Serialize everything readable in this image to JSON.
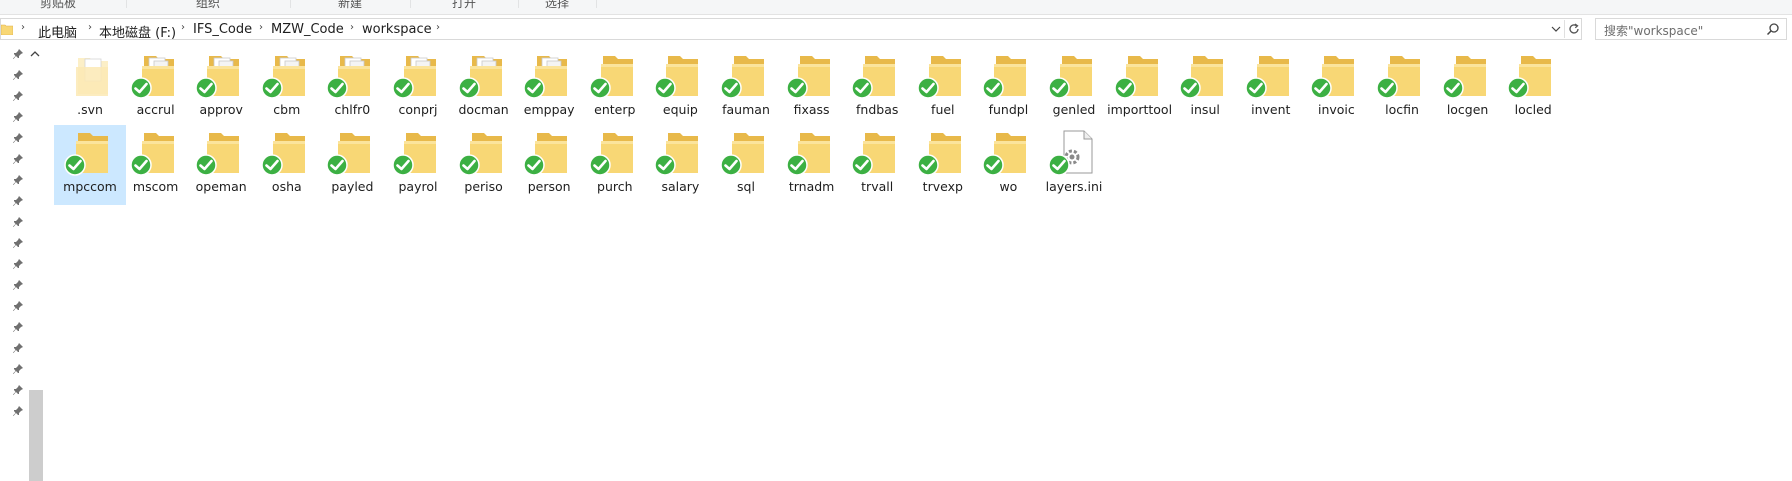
{
  "ribbon": {
    "groups": [
      "剪贴板",
      "组织",
      "新建",
      "打开",
      "选择"
    ]
  },
  "address": {
    "crumbs": [
      "此电脑",
      "本地磁盘 (F:)",
      "IFS_Code",
      "MZW_Code",
      "workspace"
    ],
    "dropdown_icon": "chevron-down-icon",
    "refresh_icon": "refresh-icon"
  },
  "search": {
    "placeholder": "搜索\"workspace\""
  },
  "colors": {
    "folder": "#f8d775",
    "folder_dark": "#e8b94a",
    "check_green": "#3cb043",
    "selected_bg": "#cce8ff"
  },
  "files": {
    "row1": [
      {
        "name": ".svn",
        "type": "folder-hidden",
        "overlay": "none"
      },
      {
        "name": "accrul",
        "type": "folder-docs",
        "overlay": "check"
      },
      {
        "name": "approv",
        "type": "folder-docs",
        "overlay": "check"
      },
      {
        "name": "cbm",
        "type": "folder-docs",
        "overlay": "check"
      },
      {
        "name": "chlfr0",
        "type": "folder-docs",
        "overlay": "check"
      },
      {
        "name": "conprj",
        "type": "folder-docs",
        "overlay": "check"
      },
      {
        "name": "docman",
        "type": "folder-docs",
        "overlay": "check"
      },
      {
        "name": "emppay",
        "type": "folder-docs",
        "overlay": "check"
      },
      {
        "name": "enterp",
        "type": "folder",
        "overlay": "check"
      },
      {
        "name": "equip",
        "type": "folder",
        "overlay": "check"
      },
      {
        "name": "fauman",
        "type": "folder",
        "overlay": "check"
      },
      {
        "name": "fixass",
        "type": "folder",
        "overlay": "check"
      },
      {
        "name": "fndbas",
        "type": "folder",
        "overlay": "check"
      },
      {
        "name": "fuel",
        "type": "folder",
        "overlay": "check"
      },
      {
        "name": "fundpl",
        "type": "folder",
        "overlay": "check"
      },
      {
        "name": "genled",
        "type": "folder",
        "overlay": "check"
      },
      {
        "name": "importtool",
        "type": "folder",
        "overlay": "check"
      },
      {
        "name": "insul",
        "type": "folder",
        "overlay": "check"
      },
      {
        "name": "invent",
        "type": "folder",
        "overlay": "check"
      },
      {
        "name": "invoic",
        "type": "folder",
        "overlay": "check"
      },
      {
        "name": "locfin",
        "type": "folder",
        "overlay": "check"
      },
      {
        "name": "locgen",
        "type": "folder",
        "overlay": "check"
      },
      {
        "name": "locled",
        "type": "folder",
        "overlay": "check"
      }
    ],
    "row2": [
      {
        "name": "mpccom",
        "type": "folder",
        "overlay": "check",
        "selected": true
      },
      {
        "name": "mscom",
        "type": "folder",
        "overlay": "check"
      },
      {
        "name": "opeman",
        "type": "folder",
        "overlay": "check"
      },
      {
        "name": "osha",
        "type": "folder",
        "overlay": "check"
      },
      {
        "name": "payled",
        "type": "folder",
        "overlay": "check"
      },
      {
        "name": "payrol",
        "type": "folder",
        "overlay": "check"
      },
      {
        "name": "periso",
        "type": "folder",
        "overlay": "check"
      },
      {
        "name": "person",
        "type": "folder",
        "overlay": "check"
      },
      {
        "name": "purch",
        "type": "folder",
        "overlay": "check"
      },
      {
        "name": "salary",
        "type": "folder",
        "overlay": "check"
      },
      {
        "name": "sql",
        "type": "folder",
        "overlay": "check"
      },
      {
        "name": "trnadm",
        "type": "folder",
        "overlay": "check"
      },
      {
        "name": "trvall",
        "type": "folder",
        "overlay": "check"
      },
      {
        "name": "trvexp",
        "type": "folder",
        "overlay": "check"
      },
      {
        "name": "wo",
        "type": "folder",
        "overlay": "check"
      },
      {
        "name": "layers.ini",
        "type": "settings-file",
        "overlay": "check"
      }
    ]
  }
}
